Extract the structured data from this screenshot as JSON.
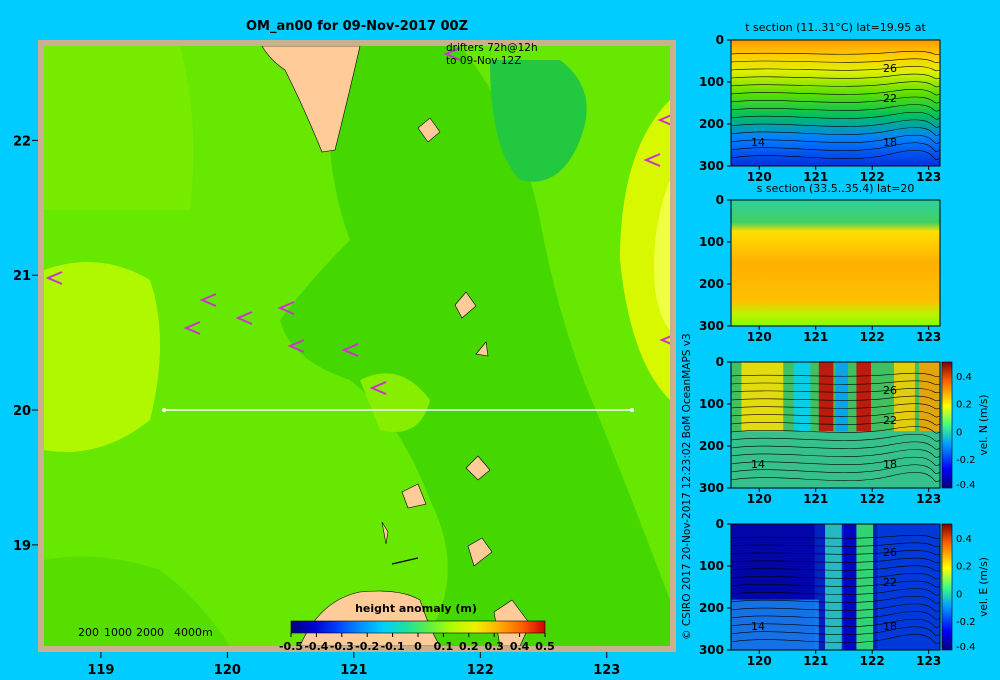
{
  "figure": {
    "background_color": "#00ccff",
    "credit": "© CSIRO 2017   20-Nov-2017 12:23:02 BoM OceanMAPS v3"
  },
  "chart_data": [
    {
      "type": "heatmap",
      "id": "map",
      "title": "OM_an00 for 09-Nov-2017 00Z",
      "x_ticks": [
        119,
        120,
        121,
        122,
        123
      ],
      "y_ticks": [
        19,
        20,
        21,
        22
      ],
      "xlim": [
        118.55,
        123.5
      ],
      "ylim": [
        18.25,
        22.7
      ],
      "drifters_label": [
        "drifters 72h@12h",
        "to 09-Nov 12Z"
      ],
      "section_line": {
        "x": [
          119.5,
          123.2
        ],
        "y": [
          20,
          20
        ]
      },
      "depth_legend": [
        "200",
        "1000",
        "2000",
        "4000m"
      ],
      "colorbar": {
        "label": "height anomaly (m)",
        "ticks": [
          "-0.5",
          "-0.4",
          "-0.3",
          "-0.2",
          "-0.1",
          "0",
          "0.1",
          "0.2",
          "0.3",
          "0.4",
          "0.5"
        ],
        "colors": [
          "#000080",
          "#0000d0",
          "#0040ff",
          "#0090ff",
          "#00d0ff",
          "#20e0a0",
          "#60f040",
          "#b0ff00",
          "#f0f000",
          "#ffb000",
          "#ff6000",
          "#d00000"
        ]
      },
      "land_color": "#ffcc99",
      "drifter_color": "#cc33cc"
    },
    {
      "type": "heatmap",
      "id": "t_section",
      "title": "t section (11..31°C) lat=19.95 at",
      "x_ticks": [
        120,
        121,
        122,
        123
      ],
      "y_ticks": [
        0,
        100,
        200,
        300
      ],
      "xlim": [
        119.5,
        123.2
      ],
      "ylim": [
        300,
        0
      ],
      "contour_labels": [
        "26",
        "22",
        "18",
        "14"
      ]
    },
    {
      "type": "heatmap",
      "id": "s_section",
      "title": "s section (33.5..35.4) lat=20",
      "x_ticks": [
        120,
        121,
        122,
        123
      ],
      "y_ticks": [
        0,
        100,
        200,
        300
      ],
      "xlim": [
        119.5,
        123.2
      ],
      "ylim": [
        300,
        0
      ]
    },
    {
      "type": "heatmap",
      "id": "vn_section",
      "x_ticks": [
        120,
        121,
        122,
        123
      ],
      "y_ticks": [
        0,
        100,
        200,
        300
      ],
      "xlim": [
        119.5,
        123.2
      ],
      "ylim": [
        300,
        0
      ],
      "contour_labels": [
        "26",
        "22",
        "18",
        "14"
      ],
      "colorbar": {
        "label": "vel. N (m/s)",
        "ticks": [
          "0.4",
          "0.2",
          "0",
          "-0.2",
          "-0.4"
        ]
      }
    },
    {
      "type": "heatmap",
      "id": "ve_section",
      "x_ticks": [
        120,
        121,
        122,
        123
      ],
      "y_ticks": [
        0,
        100,
        200,
        300
      ],
      "xlim": [
        119.5,
        123.2
      ],
      "ylim": [
        300,
        0
      ],
      "contour_labels": [
        "26",
        "22",
        "18",
        "14"
      ],
      "colorbar": {
        "label": "vel. E (m/s)",
        "ticks": [
          "0.4",
          "0.2",
          "0",
          "-0.2",
          "-0.4"
        ]
      }
    }
  ]
}
